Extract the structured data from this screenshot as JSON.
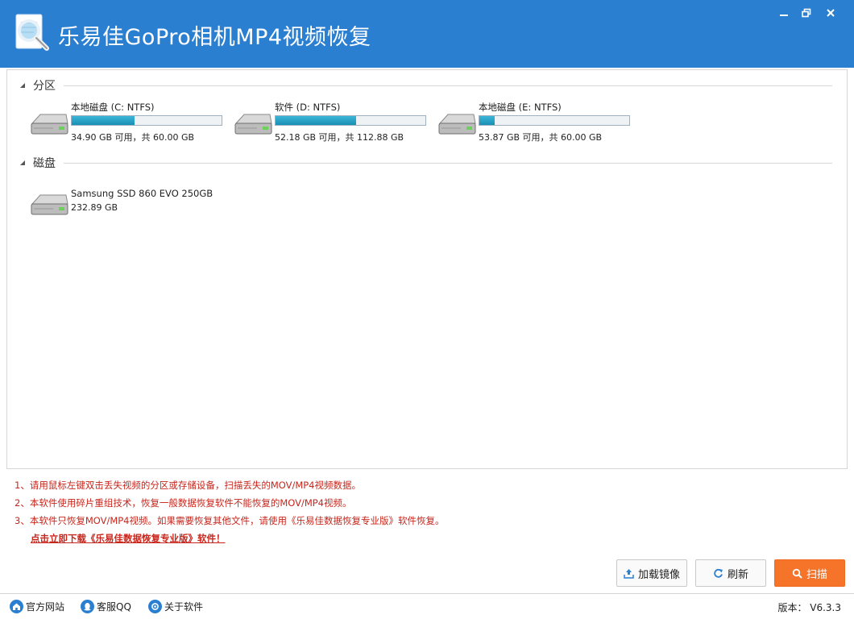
{
  "window": {
    "title": "乐易佳GoPro相机MP4视频恢复",
    "accent_color": "#2b7fd1"
  },
  "sections": {
    "partitions": {
      "title": "分区"
    },
    "disks": {
      "title": "磁盘"
    }
  },
  "partitions": [
    {
      "name": "本地磁盘 (C: NTFS)",
      "info": "34.90 GB 可用，共 60.00 GB",
      "used_fraction": 0.418
    },
    {
      "name": "软件 (D: NTFS)",
      "info": "52.18 GB 可用，共 112.88 GB",
      "used_fraction": 0.538
    },
    {
      "name": "本地磁盘 (E: NTFS)",
      "info": "53.87 GB 可用，共 60.00 GB",
      "used_fraction": 0.102
    }
  ],
  "disks": [
    {
      "name": "Samsung SSD 860 EVO 250GB",
      "info": "232.89 GB"
    }
  ],
  "tips": [
    "1、请用鼠标左键双击丢失视频的分区或存储设备，扫描丢失的MOV/MP4视频数据。",
    "2、本软件使用碎片重组技术，恢复一般数据恢复软件不能恢复的MOV/MP4视频。",
    "3、本软件只恢复MOV/MP4视频。如果需要恢复其他文件，请使用《乐易佳数据恢复专业版》软件恢复。"
  ],
  "download_link": "点击立即下载《乐易佳数据恢复专业版》软件！",
  "buttons": {
    "load_image": "加载镜像",
    "refresh": "刷新",
    "scan": "扫描"
  },
  "statusbar": {
    "website": "官方网站",
    "qq": "客服QQ",
    "about": "关于软件",
    "version": "版本：  V6.3.3"
  },
  "icons": {
    "minimize": "minimize-icon",
    "restore": "restore-icon",
    "close": "close-icon",
    "app": "magnifier-document-icon",
    "drive": "hard-drive-icon",
    "upload": "upload-icon",
    "refresh": "refresh-icon",
    "search": "search-icon",
    "home": "home-icon",
    "qq": "qq-icon",
    "info": "info-icon"
  }
}
